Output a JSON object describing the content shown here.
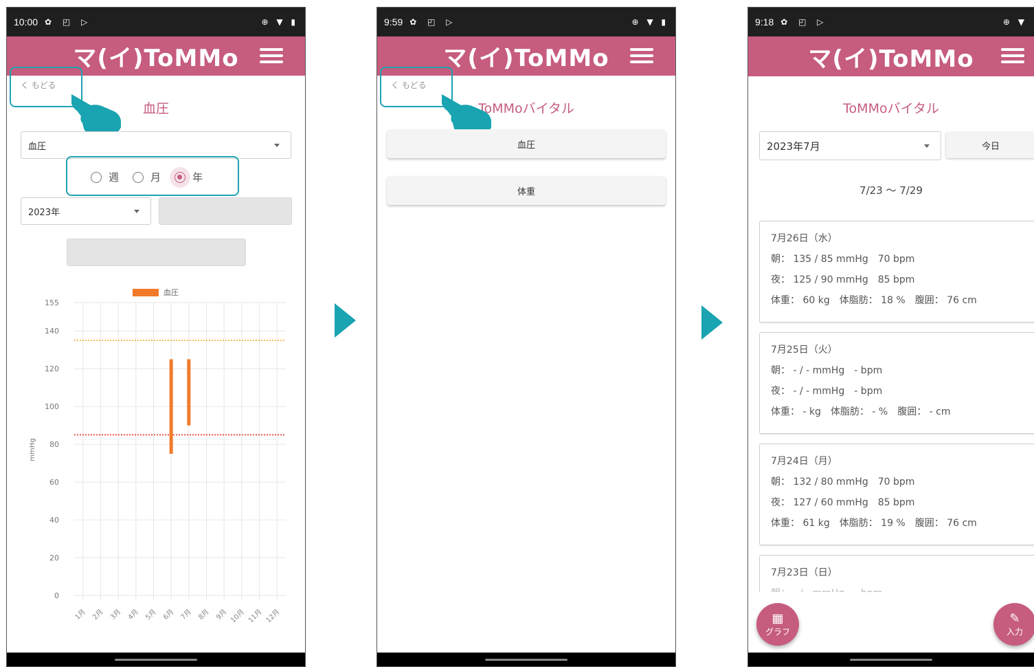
{
  "status_bars": [
    {
      "time": "10:00",
      "icons": "✿ ◰ ▷",
      "right": "⊕ ▼ ▮"
    },
    {
      "time": "9:59",
      "icons": "✿ ◰ ▷",
      "right": "⊕ ▼ ▮"
    },
    {
      "time": "9:18",
      "icons": "✿ ◰ ▷",
      "right": "⊕ ▼"
    }
  ],
  "app": {
    "logo": "マ(イ)ToMMo",
    "menu_icon": "hamburger-icon",
    "brand_color": "#c65c7e",
    "accent_color": "#1aa3b0"
  },
  "screen1": {
    "back_label": "く もどる",
    "title": "血圧",
    "vital_select": "血圧",
    "period_options": [
      {
        "label": "週",
        "checked": false
      },
      {
        "label": "月",
        "checked": false
      },
      {
        "label": "年",
        "checked": true
      }
    ],
    "year_select": "2023年"
  },
  "chart_data": {
    "type": "bar",
    "legend": [
      "血圧"
    ],
    "legend_position": "top",
    "ylabel": "mmHg",
    "ylim": [
      0,
      155
    ],
    "yticks": [
      0,
      20,
      40,
      60,
      80,
      100,
      120,
      140,
      155
    ],
    "categories": [
      "1月",
      "2月",
      "3月",
      "4月",
      "5月",
      "6月",
      "7月",
      "8月",
      "9月",
      "10月",
      "11月",
      "12月"
    ],
    "series": [
      {
        "name": "血圧",
        "ranges": [
          null,
          null,
          null,
          null,
          null,
          [
            75,
            125
          ],
          [
            90,
            125
          ],
          null,
          null,
          null,
          null,
          null
        ]
      }
    ],
    "reference_lines": [
      {
        "value": 135,
        "color": "#f5a623"
      },
      {
        "value": 85,
        "color": "#e02020"
      }
    ],
    "bar_color": "#f07a2a",
    "grid": true
  },
  "screen2": {
    "back_label": "く もどる",
    "title": "ToMMoバイタル",
    "buttons": [
      "血圧",
      "体重"
    ]
  },
  "screen3": {
    "title": "ToMMoバイタル",
    "month_select": "2023年7月",
    "today_label": "今日",
    "range": "7/23 ～ 7/29",
    "cards": [
      {
        "date": "7月26日（水）",
        "morning": "朝： 135 / 85 mmHg　70 bpm",
        "night": "夜： 125 / 90 mmHg　85 bpm",
        "body": "体重： 60 kg　体脂肪： 18 %　腹囲： 76 cm"
      },
      {
        "date": "7月25日（火）",
        "morning": "朝： - / - mmHg　- bpm",
        "night": "夜： - / - mmHg　- bpm",
        "body": "体重： - kg　体脂肪： - %　腹囲： - cm"
      },
      {
        "date": "7月24日（月）",
        "morning": "朝： 132 / 80 mmHg　70 bpm",
        "night": "夜： 127 / 60 mmHg　85 bpm",
        "body": "体重： 61 kg　体脂肪： 19 %　腹囲： 76 cm"
      },
      {
        "date": "7月23日（日）",
        "morning": "朝： - / - mmHg　- bpm",
        "night": "",
        "body": ""
      }
    ],
    "fab_graph": "グラフ",
    "fab_input": "入力"
  }
}
